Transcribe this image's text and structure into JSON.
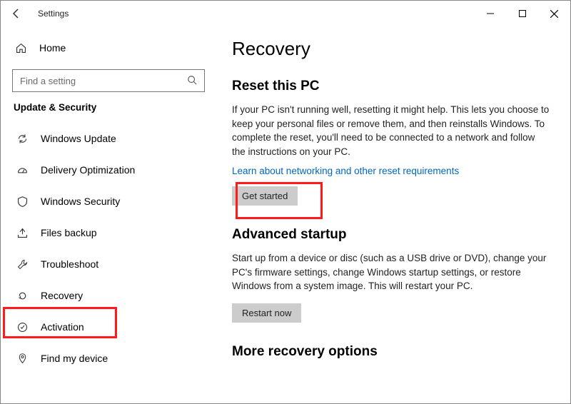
{
  "titlebar": {
    "title": "Settings"
  },
  "sidebar": {
    "home_label": "Home",
    "search_placeholder": "Find a setting",
    "category_label": "Update & Security",
    "items": [
      {
        "label": "Windows Update"
      },
      {
        "label": "Delivery Optimization"
      },
      {
        "label": "Windows Security"
      },
      {
        "label": "Files backup"
      },
      {
        "label": "Troubleshoot"
      },
      {
        "label": "Recovery"
      },
      {
        "label": "Activation"
      },
      {
        "label": "Find my device"
      }
    ]
  },
  "main": {
    "page_title": "Recovery",
    "reset": {
      "title": "Reset this PC",
      "body": "If your PC isn't running well, resetting it might help. This lets you choose to keep your personal files or remove them, and then reinstalls Windows. To complete the reset, you'll need to be connected to a network and follow the instructions on your PC.",
      "link": "Learn about networking and other reset requirements",
      "button": "Get started"
    },
    "advanced": {
      "title": "Advanced startup",
      "body": "Start up from a device or disc (such as a USB drive or DVD), change your PC's firmware settings, change Windows startup settings, or restore Windows from a system image. This will restart your PC.",
      "button": "Restart now"
    },
    "more": {
      "title": "More recovery options"
    }
  }
}
